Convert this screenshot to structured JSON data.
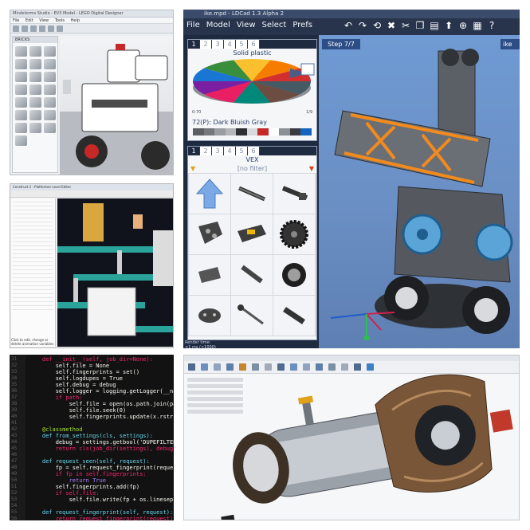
{
  "lego_designer": {
    "title": "Mindstorms Studio - EV3 Model - LEGO Digital Designer",
    "menu": [
      "File",
      "Edit",
      "View",
      "Tools",
      "Help"
    ],
    "palette_header": "BRICKS"
  },
  "ldcad": {
    "title": "ike.mpd - LDCad 1.3 Alpha 2",
    "menu": [
      "File",
      "Model",
      "View",
      "Select",
      "Prefs"
    ],
    "color_bin": {
      "tabs": [
        "1",
        "2",
        "3",
        "4",
        "5",
        "6"
      ],
      "header": "Solid plastic",
      "range_left": "0-70",
      "range_right": "1/9",
      "selected": "72(P): Dark Bluish Gray"
    },
    "part_bin": {
      "tabs": [
        "1",
        "2",
        "3",
        "4",
        "5",
        "6"
      ],
      "header": "VEX",
      "filter": "[no filter]"
    },
    "step_label": "Step 7/7",
    "step_right": "ike",
    "render_time": "Render time:\n<1 ms (<1000)"
  },
  "platformer": {
    "title": "Construct 2 - Platformer Level Editor",
    "bottom_text": "Click to edit, change or delete animation variables"
  },
  "code_editor": {
    "lines": [
      {
        "n": "31",
        "t": "    def __init__(self, job_dir=None):",
        "c": "#f92672"
      },
      {
        "n": "32",
        "t": "        self.file = None",
        "c": "#f8f8f2"
      },
      {
        "n": "33",
        "t": "        self.fingerprints = set()",
        "c": "#f8f8f2"
      },
      {
        "n": "34",
        "t": "        self.logdupes = True",
        "c": "#f8f8f2"
      },
      {
        "n": "35",
        "t": "        self.debug = debug",
        "c": "#f8f8f2"
      },
      {
        "n": "36",
        "t": "        self.logger = logging.getLogger(__name__)",
        "c": "#f8f8f2"
      },
      {
        "n": "37",
        "t": "        if path:",
        "c": "#f92672"
      },
      {
        "n": "38",
        "t": "            self.file = open(os.path.join(path,",
        "c": "#f8f8f2"
      },
      {
        "n": "39",
        "t": "            self.file.seek(0)",
        "c": "#f8f8f2"
      },
      {
        "n": "40",
        "t": "            self.fingerprints.update(x.rstrip()",
        "c": "#f8f8f2"
      },
      {
        "n": "41",
        "t": "",
        "c": "#f8f8f2"
      },
      {
        "n": "42",
        "t": "    @classmethod",
        "c": "#a6e22e"
      },
      {
        "n": "43",
        "t": "    def from_settings(cls, settings):",
        "c": "#66d9ef"
      },
      {
        "n": "44",
        "t": "        debug = settings.getbool('DUPEFILTER_DEBUG')",
        "c": "#f8f8f2"
      },
      {
        "n": "45",
        "t": "        return cls(job_dir(settings), debug)",
        "c": "#f92672"
      },
      {
        "n": "46",
        "t": "",
        "c": "#f8f8f2"
      },
      {
        "n": "47",
        "t": "    def request_seen(self, request):",
        "c": "#66d9ef"
      },
      {
        "n": "48",
        "t": "        fp = self.request_fingerprint(request)",
        "c": "#f8f8f2"
      },
      {
        "n": "49",
        "t": "        if fp in self.fingerprints:",
        "c": "#f92672"
      },
      {
        "n": "50",
        "t": "            return True",
        "c": "#ae81ff"
      },
      {
        "n": "51",
        "t": "        self.fingerprints.add(fp)",
        "c": "#f8f8f2"
      },
      {
        "n": "52",
        "t": "        if self.file:",
        "c": "#f92672"
      },
      {
        "n": "53",
        "t": "            self.file.write(fp + os.linesep)",
        "c": "#f8f8f2"
      },
      {
        "n": "54",
        "t": "",
        "c": "#f8f8f2"
      },
      {
        "n": "55",
        "t": "    def request_fingerprint(self, request):",
        "c": "#66d9ef"
      },
      {
        "n": "56",
        "t": "        return request_fingerprint(request)",
        "c": "#f92672"
      }
    ]
  },
  "cad": {
    "browser_items": 6
  },
  "colors": {
    "ldcad_dark": "#27344c",
    "ldcad_view": "#6f9ad3",
    "highlight_orange": "#f28a1e",
    "code_bg": "#121212"
  }
}
